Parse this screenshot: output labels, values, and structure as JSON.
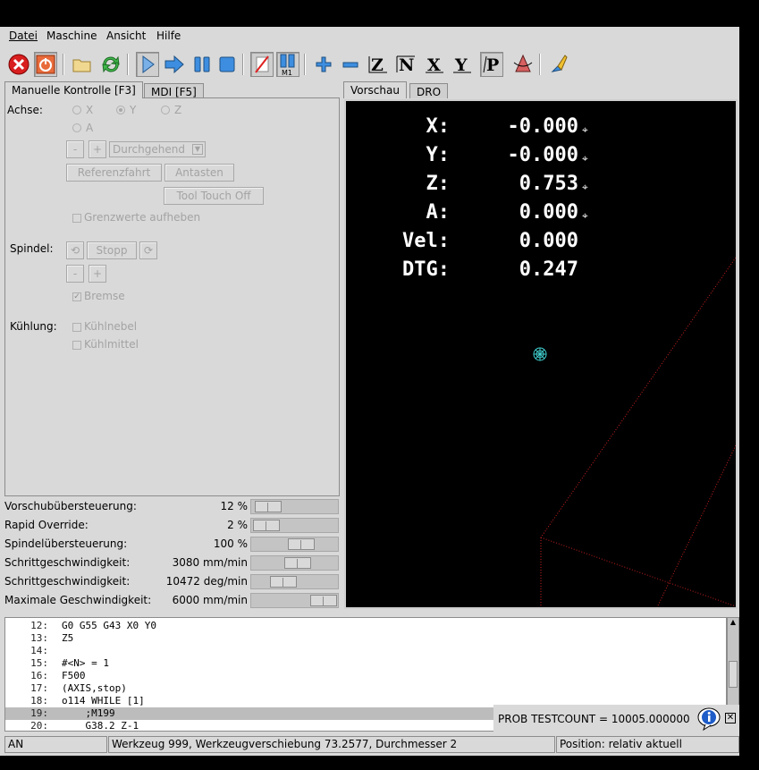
{
  "menu": [
    "Datei",
    "Maschine",
    "Ansicht",
    "Hilfe"
  ],
  "toolbar": {
    "icons": [
      "estop-icon",
      "machine-power-icon",
      "open-file-icon",
      "reload-icon",
      "run-icon",
      "step-icon",
      "pause-icon",
      "stop-icon",
      "block-delete-icon",
      "optional-stop-icon",
      "zoom-in-icon",
      "zoom-out-icon",
      "view-z-icon",
      "view-z2-icon",
      "view-x-icon",
      "view-y-icon",
      "view-p-icon",
      "rotate-view-icon",
      "clear-plot-icon"
    ],
    "m1_label": "M1"
  },
  "left_tabs": [
    "Manuelle Kontrolle [F3]",
    "MDI [F5]"
  ],
  "right_tabs": [
    "Vorschau",
    "DRO"
  ],
  "manual": {
    "axis_label": "Achse:",
    "axes": [
      "X",
      "Y",
      "Z",
      "A"
    ],
    "selected_axis": "Y",
    "minus": "-",
    "plus": "+",
    "jog_mode": "Durchgehend",
    "home_button": "Referenzfahrt",
    "touch_off_button": "Antasten",
    "tool_touch_off_button": "Tool Touch Off",
    "override_limits": "Grenzwerte aufheben",
    "spindle_label": "Spindel:",
    "spindle_stop": "Stopp",
    "brake": "Bremse",
    "coolant_label": "Kühlung:",
    "mist": "Kühlnebel",
    "flood": "Kühlmittel"
  },
  "sliders": [
    {
      "name": "Vorschubübersteuerung:",
      "value": "12 %",
      "fraction": 0.05
    },
    {
      "name": "Rapid Override:",
      "value": "2 %",
      "fraction": 0.02
    },
    {
      "name": "Spindelübersteuerung:",
      "value": "100 %",
      "fraction": 0.62
    },
    {
      "name": "Schrittgeschwindigkeit:",
      "value": "3080 mm/min",
      "fraction": 0.56
    },
    {
      "name": "Schrittgeschwindigkeit:",
      "value": "10472 deg/min",
      "fraction": 0.3
    },
    {
      "name": "Maximale Geschwindigkeit:",
      "value": "6000 mm/min",
      "fraction": 1.0
    }
  ],
  "dro": [
    {
      "label": "X:",
      "value": "-0.000"
    },
    {
      "label": "Y:",
      "value": "-0.000"
    },
    {
      "label": "Z:",
      "value": "0.753"
    },
    {
      "label": "A:",
      "value": "0.000"
    },
    {
      "label": "Vel:",
      "value": "0.000"
    },
    {
      "label": "DTG:",
      "value": "0.247"
    }
  ],
  "code": [
    {
      "n": "12:",
      "t": "G0 G55 G43 X0 Y0"
    },
    {
      "n": "13:",
      "t": "Z5"
    },
    {
      "n": "14:",
      "t": ""
    },
    {
      "n": "15:",
      "t": "#<N> = 1"
    },
    {
      "n": "16:",
      "t": "F500"
    },
    {
      "n": "17:",
      "t": "(AXIS,stop)"
    },
    {
      "n": "18:",
      "t": "o114 WHILE [1]"
    },
    {
      "n": "19:",
      "t": "    ;M199"
    },
    {
      "n": "20:",
      "t": "    G38.2 Z-1"
    }
  ],
  "notification": "PROB TESTCOUNT = 10005.000000",
  "status": {
    "mode": "AN",
    "tool": "Werkzeug 999, Werkzeugverschiebung 73.2577, Durchmesser 2",
    "position": "Position: relativ aktuell"
  }
}
